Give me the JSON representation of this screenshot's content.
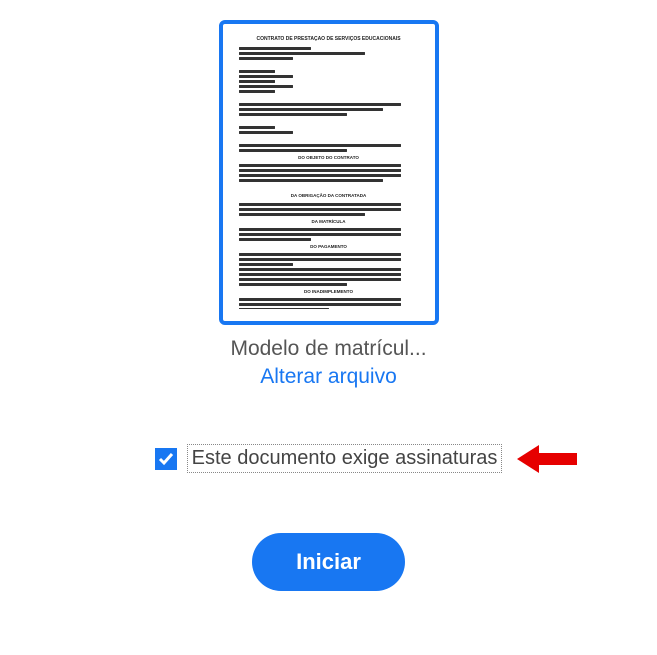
{
  "document": {
    "file_name": "Modelo de matrícul...",
    "change_link_label": "Alterar arquivo"
  },
  "signature": {
    "checkbox_label": "Este documento exige assinaturas",
    "checked": true
  },
  "actions": {
    "start_label": "Iniciar"
  },
  "colors": {
    "primary": "#1877f2",
    "arrow": "#e60000"
  }
}
